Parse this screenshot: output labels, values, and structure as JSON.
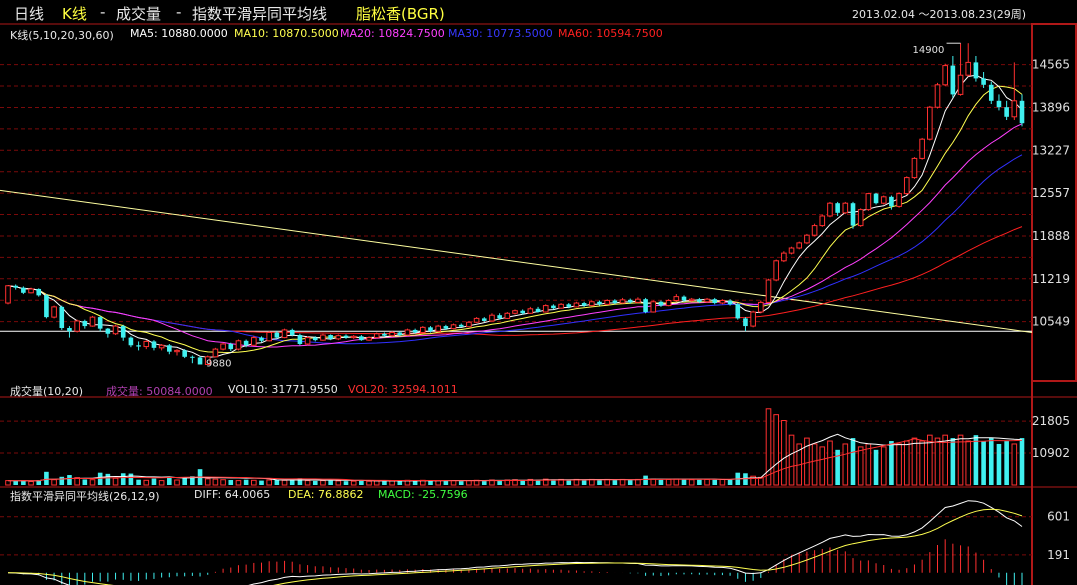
{
  "header": {
    "period": "日线",
    "chart_type": "K线",
    "sep1": "-",
    "volume": "成交量",
    "sep2": "-",
    "indicator": "指数平滑异同平均线",
    "instrument": "脂松香(BGR)",
    "date_range": "2013.02.04 ～2013.08.23(29周)"
  },
  "colors": {
    "bg": "#000000",
    "grid": "#7a0a0a",
    "frame": "#b01818",
    "up": "#ff3030",
    "down": "#40f0f0",
    "ma5": "#ffffff",
    "ma10": "#ffff50",
    "ma20": "#ff40ff",
    "ma30": "#3030ff",
    "ma60": "#ff2020",
    "trend": "#ffffa0",
    "axis_text": "#e0e0e0"
  },
  "main_panel": {
    "legend_title": "K线(5,10,20,30,60)",
    "ma_labels": [
      "MA5: 10880.0000",
      "MA10: 10870.5000",
      "MA20: 10824.7500",
      "MA30: 10773.5000",
      "MA60: 10594.7500"
    ],
    "y_ticks": [
      "14565",
      "13896",
      "13227",
      "12557",
      "11888",
      "11219",
      "10549"
    ],
    "high_label": "14900",
    "low_label": "9880"
  },
  "volume_panel": {
    "legend_title": "成交量(10,20)",
    "labels": [
      "成交量: 50084.0000",
      "VOL10: 31771.9550",
      "VOL20: 32594.1011"
    ],
    "y_ticks": [
      "21805",
      "10902"
    ]
  },
  "macd_panel": {
    "legend_title": "指数平滑异同平均线(26,12,9)",
    "labels": [
      "DIFF: 64.0065",
      "DEA: 76.8862",
      "MACD: -25.7596"
    ],
    "y_ticks": [
      "601",
      "191"
    ]
  },
  "chart_data": {
    "type": "candlestick",
    "instrument": "脂松香(BGR)",
    "ylim": [
      9700,
      14950
    ],
    "vol_ylim": [
      0,
      29000
    ],
    "macd_ylim": [
      -110,
      780
    ],
    "candles": [
      [
        10840,
        11110,
        10820,
        11120,
        1500
      ],
      [
        11110,
        11080,
        11050,
        11130,
        1400
      ],
      [
        11080,
        11000,
        10980,
        11100,
        1600
      ],
      [
        11000,
        11060,
        10990,
        11080,
        1200
      ],
      [
        11060,
        10960,
        10940,
        11070,
        1700
      ],
      [
        10960,
        10620,
        10600,
        10980,
        4500
      ],
      [
        10620,
        10780,
        10600,
        10800,
        1800
      ],
      [
        10780,
        10450,
        10420,
        10800,
        2800
      ],
      [
        10450,
        10400,
        10300,
        10480,
        3400
      ],
      [
        10400,
        10560,
        10380,
        10580,
        2500
      ],
      [
        10560,
        10480,
        10440,
        10580,
        1900
      ],
      [
        10480,
        10620,
        10470,
        10640,
        1800
      ],
      [
        10620,
        10440,
        10400,
        10640,
        4200
      ],
      [
        10440,
        10360,
        10300,
        10450,
        3800
      ],
      [
        10360,
        10480,
        10340,
        10500,
        2300
      ],
      [
        10480,
        10300,
        10250,
        10500,
        4000
      ],
      [
        10300,
        10180,
        10150,
        10320,
        3900
      ],
      [
        10180,
        10160,
        10100,
        10240,
        1800
      ],
      [
        10160,
        10240,
        10120,
        10260,
        1600
      ],
      [
        10240,
        10140,
        10100,
        10260,
        2200
      ],
      [
        10140,
        10180,
        10100,
        10200,
        1500
      ],
      [
        10180,
        10080,
        10040,
        10200,
        2400
      ],
      [
        10080,
        10100,
        10020,
        10120,
        1700
      ],
      [
        10100,
        10000,
        9980,
        10120,
        2600
      ],
      [
        10000,
        9990,
        9900,
        10020,
        3000
      ],
      [
        9990,
        9880,
        9880,
        10010,
        5400
      ],
      [
        9880,
        10000,
        9880,
        10020,
        2100
      ],
      [
        10000,
        10120,
        9990,
        10140,
        2000
      ],
      [
        10120,
        10200,
        10100,
        10220,
        1800
      ],
      [
        10200,
        10120,
        10090,
        10220,
        1700
      ],
      [
        10120,
        10250,
        10100,
        10270,
        1500
      ],
      [
        10250,
        10180,
        10150,
        10270,
        1800
      ],
      [
        10180,
        10300,
        10170,
        10330,
        1600
      ],
      [
        10300,
        10250,
        10230,
        10320,
        1500
      ],
      [
        10250,
        10380,
        10240,
        10400,
        1700
      ],
      [
        10380,
        10300,
        10280,
        10400,
        1800
      ],
      [
        10300,
        10420,
        10290,
        10440,
        1600
      ],
      [
        10420,
        10340,
        10320,
        10440,
        1900
      ],
      [
        10340,
        10200,
        10180,
        10360,
        2300
      ],
      [
        10200,
        10300,
        10180,
        10320,
        1500
      ],
      [
        10300,
        10260,
        10240,
        10320,
        1400
      ],
      [
        10260,
        10340,
        10250,
        10360,
        1500
      ],
      [
        10340,
        10280,
        10260,
        10350,
        1500
      ],
      [
        10280,
        10330,
        10260,
        10350,
        1400
      ],
      [
        10330,
        10300,
        10280,
        10350,
        1300
      ],
      [
        10300,
        10320,
        10280,
        10340,
        1300
      ],
      [
        10320,
        10260,
        10250,
        10340,
        1500
      ],
      [
        10260,
        10300,
        10250,
        10320,
        1300
      ],
      [
        10300,
        10360,
        10290,
        10380,
        1400
      ],
      [
        10360,
        10330,
        10310,
        10380,
        1300
      ],
      [
        10330,
        10380,
        10320,
        10400,
        1400
      ],
      [
        10380,
        10340,
        10320,
        10400,
        1500
      ],
      [
        10340,
        10420,
        10330,
        10440,
        1600
      ],
      [
        10420,
        10380,
        10360,
        10440,
        1500
      ],
      [
        10380,
        10460,
        10370,
        10480,
        1600
      ],
      [
        10460,
        10400,
        10380,
        10480,
        1700
      ],
      [
        10400,
        10480,
        10390,
        10500,
        1500
      ],
      [
        10480,
        10440,
        10420,
        10500,
        1600
      ],
      [
        10440,
        10500,
        10430,
        10520,
        1500
      ],
      [
        10500,
        10470,
        10460,
        10520,
        1400
      ],
      [
        10470,
        10540,
        10460,
        10560,
        1500
      ],
      [
        10540,
        10600,
        10530,
        10620,
        1600
      ],
      [
        10600,
        10560,
        10540,
        10620,
        1500
      ],
      [
        10560,
        10650,
        10550,
        10680,
        1700
      ],
      [
        10650,
        10600,
        10580,
        10680,
        1600
      ],
      [
        10600,
        10680,
        10590,
        10700,
        1700
      ],
      [
        10680,
        10720,
        10660,
        10740,
        1800
      ],
      [
        10720,
        10680,
        10660,
        10740,
        1700
      ],
      [
        10680,
        10750,
        10670,
        10780,
        1900
      ],
      [
        10750,
        10700,
        10690,
        10780,
        1800
      ],
      [
        10700,
        10800,
        10690,
        10820,
        2000
      ],
      [
        10800,
        10760,
        10740,
        10820,
        1900
      ],
      [
        10760,
        10820,
        10750,
        10840,
        1900
      ],
      [
        10820,
        10780,
        10760,
        10840,
        1800
      ],
      [
        10780,
        10840,
        10770,
        10860,
        1900
      ],
      [
        10840,
        10800,
        10780,
        10860,
        1800
      ],
      [
        10800,
        10860,
        10790,
        10880,
        1900
      ],
      [
        10860,
        10820,
        10800,
        10880,
        1800
      ],
      [
        10820,
        10880,
        10810,
        10900,
        1900
      ],
      [
        10880,
        10840,
        10820,
        10900,
        1800
      ],
      [
        10840,
        10890,
        10830,
        10920,
        1900
      ],
      [
        10890,
        10850,
        10830,
        10910,
        1800
      ],
      [
        10850,
        10900,
        10840,
        10930,
        1900
      ],
      [
        10900,
        10700,
        10680,
        10920,
        3200
      ],
      [
        10700,
        10860,
        10690,
        10880,
        2000
      ],
      [
        10860,
        10800,
        10780,
        10880,
        1800
      ],
      [
        10800,
        10880,
        10790,
        10900,
        1900
      ],
      [
        10880,
        10940,
        10860,
        10980,
        2000
      ],
      [
        10940,
        10880,
        10860,
        10960,
        1900
      ],
      [
        10880,
        10900,
        10860,
        10920,
        1800
      ],
      [
        10900,
        10860,
        10840,
        10920,
        1800
      ],
      [
        10860,
        10900,
        10840,
        10920,
        1900
      ],
      [
        10900,
        10840,
        10820,
        10920,
        1800
      ],
      [
        10840,
        10880,
        10820,
        10900,
        1900
      ],
      [
        10880,
        10820,
        10800,
        10900,
        1800
      ],
      [
        10820,
        10600,
        10580,
        10840,
        4200
      ],
      [
        10600,
        10480,
        10400,
        10620,
        4000
      ],
      [
        10480,
        10700,
        10460,
        10720,
        3000
      ],
      [
        10700,
        10850,
        10680,
        10880,
        2600
      ],
      [
        10850,
        11200,
        10840,
        11220,
        26000
      ],
      [
        11200,
        11500,
        11180,
        11520,
        24000
      ],
      [
        11500,
        11620,
        11480,
        11650,
        22000
      ],
      [
        11620,
        11700,
        11600,
        11720,
        17000
      ],
      [
        11700,
        11780,
        11680,
        11800,
        14000
      ],
      [
        11780,
        11900,
        11760,
        11920,
        16000
      ],
      [
        11900,
        12050,
        11880,
        12080,
        14000
      ],
      [
        12050,
        12200,
        12030,
        12220,
        13000
      ],
      [
        12200,
        12400,
        12180,
        12420,
        15000
      ],
      [
        12400,
        12250,
        12200,
        12420,
        12000
      ],
      [
        12250,
        12400,
        12230,
        12420,
        14000
      ],
      [
        12400,
        12050,
        12000,
        12420,
        16000
      ],
      [
        12050,
        12300,
        12030,
        12320,
        13000
      ],
      [
        12300,
        12550,
        12280,
        12560,
        14000
      ],
      [
        12550,
        12400,
        12380,
        12560,
        12000
      ],
      [
        12400,
        12500,
        12380,
        12520,
        13000
      ],
      [
        12500,
        12350,
        12300,
        12520,
        15000
      ],
      [
        12350,
        12550,
        12330,
        12570,
        14000
      ],
      [
        12550,
        12800,
        12530,
        12820,
        15000
      ],
      [
        12800,
        13100,
        12780,
        13120,
        16000
      ],
      [
        13100,
        13400,
        13080,
        13420,
        15000
      ],
      [
        13400,
        13900,
        13380,
        13920,
        17000
      ],
      [
        13900,
        14250,
        13880,
        14280,
        16000
      ],
      [
        14250,
        14550,
        14230,
        14580,
        17000
      ],
      [
        14550,
        14100,
        14050,
        14700,
        16000
      ],
      [
        14100,
        14400,
        14080,
        14900,
        17000
      ],
      [
        14400,
        14600,
        14380,
        14900,
        15000
      ],
      [
        14600,
        14350,
        14300,
        14700,
        17000
      ],
      [
        14350,
        14250,
        14200,
        14450,
        15000
      ],
      [
        14250,
        14000,
        13950,
        14300,
        16000
      ],
      [
        14000,
        13900,
        13850,
        14100,
        14000
      ],
      [
        13900,
        13750,
        13700,
        14000,
        15000
      ],
      [
        13750,
        14000,
        13700,
        14600,
        14000
      ],
      [
        14000,
        13650,
        13600,
        14100,
        16000
      ]
    ]
  }
}
